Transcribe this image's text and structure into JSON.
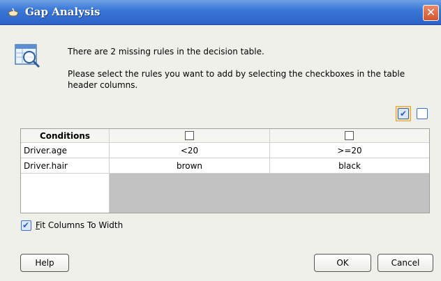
{
  "window": {
    "title": "Gap Analysis",
    "close_label": "✕"
  },
  "message": {
    "line1": "There are 2 missing rules in the decision table.",
    "line2": "Please select the rules you want to add by selecting the checkboxes in the table header columns."
  },
  "header_checkboxes": {
    "select_all_checked": true,
    "select_none_checked": false
  },
  "table": {
    "header": "Conditions",
    "rules": [
      {
        "checked": false
      },
      {
        "checked": false
      }
    ],
    "rows": [
      {
        "label": "Driver.age",
        "values": [
          "<20",
          ">=20"
        ]
      },
      {
        "label": "Driver.hair",
        "values": [
          "brown",
          "black"
        ]
      }
    ]
  },
  "options": {
    "fit_columns_label_prefix": "F",
    "fit_columns_label_rest": "it Columns To Width",
    "fit_columns_checked": true
  },
  "buttons": {
    "help": "Help",
    "ok": "OK",
    "cancel": "Cancel"
  },
  "colors": {
    "titlebar": "#2c62c7",
    "close": "#d5532d",
    "dialog_bg": "#f0f0eb",
    "table_empty": "#c2c2c2"
  }
}
